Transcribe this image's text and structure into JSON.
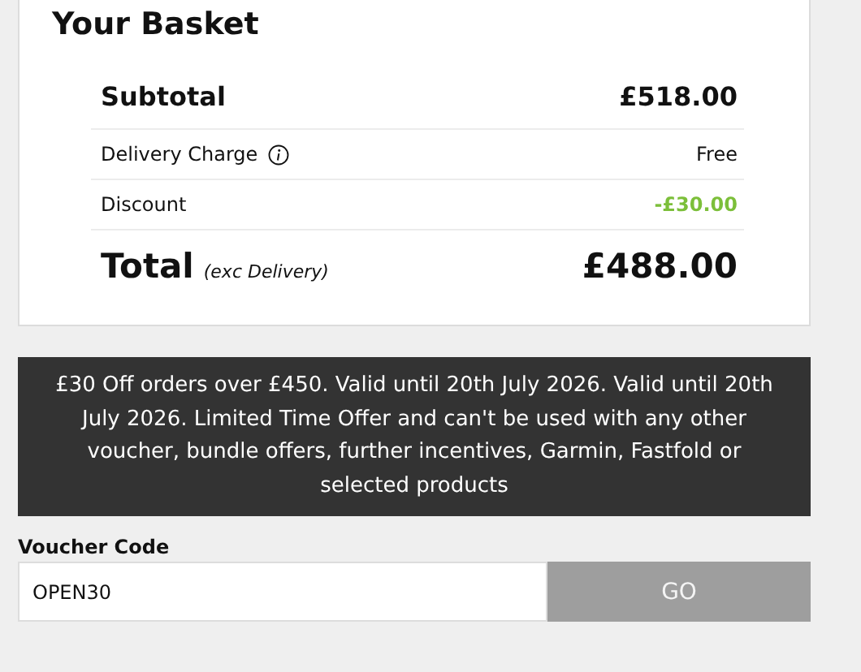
{
  "basket": {
    "title": "Your Basket",
    "rows": [
      {
        "kind": "subtotal",
        "label": "Subtotal",
        "value": "£518.00"
      },
      {
        "kind": "charge",
        "label": "Delivery Charge",
        "value": "Free"
      },
      {
        "kind": "discount",
        "label": "Discount",
        "value": "-£30.00"
      },
      {
        "kind": "total",
        "label": "Total",
        "note": "(exc Delivery)",
        "value": "£488.00"
      }
    ]
  },
  "offer": {
    "text": "£30 Off orders over £450. Valid until 20th July 2026. Valid until 20th July 2026. Limited Time Offer and can't be used with any other voucher, bundle offers, further incentives, Garmin, Fastfold or selected products"
  },
  "voucher": {
    "label": "Voucher Code",
    "value": "OPEN30",
    "button": "GO"
  }
}
